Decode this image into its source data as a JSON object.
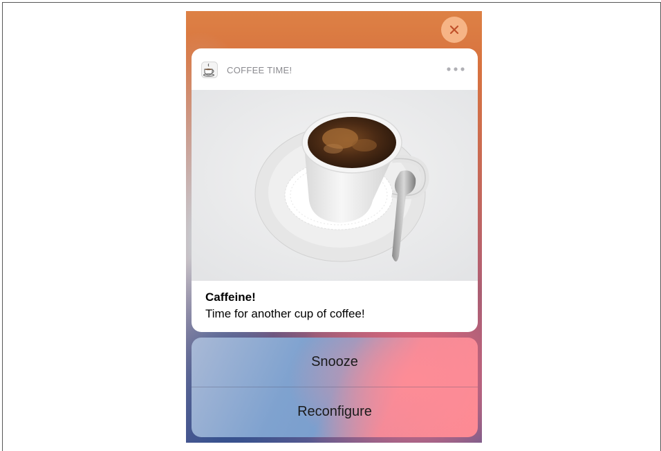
{
  "notification": {
    "app_name": "COFFEE TIME!",
    "app_icon": "coffee-cup-icon",
    "title": "Caffeine!",
    "body": "Time for another cup of coffee!"
  },
  "actions": [
    {
      "label": "Snooze"
    },
    {
      "label": "Reconfigure"
    }
  ],
  "colors": {
    "close_button_bg": "#f6b486",
    "close_glyph": "#c0502a",
    "card_bg": "#ffffff"
  }
}
